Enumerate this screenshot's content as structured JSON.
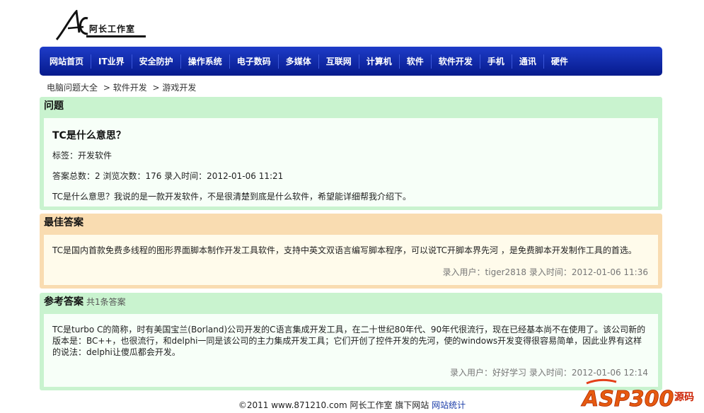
{
  "logo": {
    "text": "阿长工作室",
    "mark": "AC"
  },
  "nav": [
    "网站首页",
    "IT业界",
    "安全防护",
    "操作系统",
    "电子数码",
    "多媒体",
    "互联网",
    "计算机",
    "软件",
    "软件开发",
    "手机",
    "通讯",
    "硬件"
  ],
  "breadcrumb": [
    "电脑问题大全",
    "> 软件开发",
    "> 游戏开发"
  ],
  "question": {
    "header": "问题",
    "title": "TC是什么意思？",
    "tags": "标签：开发软件",
    "stats": "答案总数：2 浏览次数：176 录入时间：2012-01-06 11:21",
    "body": "TC是什么意思？我说的是一款开发软件，不是很清楚到底是什么软件，希望能详细帮我介绍下。"
  },
  "best_answer": {
    "header": "最佳答案",
    "body": "TC是国内首款免费多线程的图形界面脚本制作开发工具软件，支持中英文双语言编写脚本程序，可以说TC开脚本界先河  ，是免费脚本开发制作工具的首选。",
    "meta": "录入用户：tiger2818 录入时间：2012-01-06 11:36"
  },
  "ref_answer": {
    "header": "参考答案",
    "count": "共1条答案",
    "body": "TC是turbo C的简称，时有美国宝兰(Borland)公司开发的C语言集成开发工具，在二十世纪80年代、90年代很流行，现在已经基本尚不在使用了。该公司新的版本是：BC++，也很流行，和delphi一同是该公司的主力集成开发工具；它们开创了控件开发的先河，使的windows开发变得很容易简单，因此业界有这样的说法：delphi让傻瓜都会开发。",
    "meta_label": "录入用户：",
    "meta_user": "好好学习",
    "meta_time": "录入时间：2012-01-06 12:14"
  },
  "footer": {
    "text": "©2011 www.871210.com 阿长工作室 旗下网站",
    "link": "网站统计"
  },
  "watermark": {
    "text": "ASP300",
    "sub": "源码"
  }
}
